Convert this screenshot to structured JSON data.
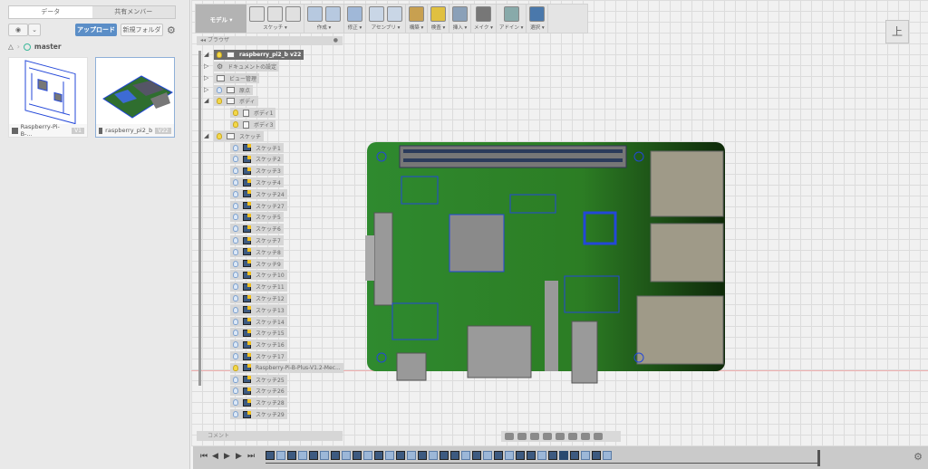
{
  "left_panel": {
    "tabs": [
      "データ",
      "共有メンバー"
    ],
    "upload_label": "アップロード",
    "new_folder_label": "新規フォルダ",
    "breadcrumb": "master",
    "files": [
      {
        "name": "Raspberry-Pi-B-...",
        "version": "V1"
      },
      {
        "name": "raspberry_pi2_b",
        "version": "V22"
      }
    ]
  },
  "toolbar": {
    "workspace": "モデル ▾",
    "groups": [
      {
        "label": "スケッチ ▾",
        "n": 3
      },
      {
        "label": "作成 ▾",
        "n": 2
      },
      {
        "label": "修正 ▾",
        "n": 1
      },
      {
        "label": "アセンブリ ▾",
        "n": 2
      },
      {
        "label": "構築 ▾",
        "n": 1
      },
      {
        "label": "検査 ▾",
        "n": 1
      },
      {
        "label": "挿入 ▾",
        "n": 1
      },
      {
        "label": "メイク ▾",
        "n": 1
      },
      {
        "label": "アドイン ▾",
        "n": 1
      },
      {
        "label": "選択 ▾",
        "n": 1
      }
    ]
  },
  "browser": {
    "title": "ブラウザ",
    "root": "raspberry_pi2_b v22",
    "items": [
      {
        "label": "ドキュメントの設定",
        "level": 1,
        "type": "gear",
        "arrow": "▷"
      },
      {
        "label": "ビュー管理",
        "level": 1,
        "type": "folder",
        "arrow": "▷"
      },
      {
        "label": "原点",
        "level": 1,
        "type": "folder",
        "arrow": "▷",
        "bulb": "off"
      },
      {
        "label": "ボディ",
        "level": 1,
        "type": "folder",
        "arrow": "◢",
        "bulb": "on"
      },
      {
        "label": "ボディ1",
        "level": 2,
        "type": "body",
        "bulb": "on"
      },
      {
        "label": "ボディ3",
        "level": 2,
        "type": "body",
        "bulb": "on"
      },
      {
        "label": "スケッチ",
        "level": 1,
        "type": "folder",
        "arrow": "◢",
        "bulb": "on"
      },
      {
        "label": "スケッチ1",
        "level": 2,
        "type": "sketch",
        "bulb": "off"
      },
      {
        "label": "スケッチ2",
        "level": 2,
        "type": "sketch",
        "bulb": "off"
      },
      {
        "label": "スケッチ3",
        "level": 2,
        "type": "sketch",
        "bulb": "off"
      },
      {
        "label": "スケッチ4",
        "level": 2,
        "type": "sketch",
        "bulb": "off"
      },
      {
        "label": "スケッチ24",
        "level": 2,
        "type": "sketch",
        "bulb": "off"
      },
      {
        "label": "スケッチ27",
        "level": 2,
        "type": "sketch",
        "bulb": "off"
      },
      {
        "label": "スケッチ5",
        "level": 2,
        "type": "sketch",
        "bulb": "off"
      },
      {
        "label": "スケッチ6",
        "level": 2,
        "type": "sketch",
        "bulb": "off"
      },
      {
        "label": "スケッチ7",
        "level": 2,
        "type": "sketch",
        "bulb": "off"
      },
      {
        "label": "スケッチ8",
        "level": 2,
        "type": "sketch",
        "bulb": "off"
      },
      {
        "label": "スケッチ9",
        "level": 2,
        "type": "sketch",
        "bulb": "off"
      },
      {
        "label": "スケッチ10",
        "level": 2,
        "type": "sketch",
        "bulb": "off"
      },
      {
        "label": "スケッチ11",
        "level": 2,
        "type": "sketch",
        "bulb": "off"
      },
      {
        "label": "スケッチ12",
        "level": 2,
        "type": "sketch",
        "bulb": "off"
      },
      {
        "label": "スケッチ13",
        "level": 2,
        "type": "sketch",
        "bulb": "off"
      },
      {
        "label": "スケッチ14",
        "level": 2,
        "type": "sketch",
        "bulb": "off"
      },
      {
        "label": "スケッチ15",
        "level": 2,
        "type": "sketch",
        "bulb": "off"
      },
      {
        "label": "スケッチ16",
        "level": 2,
        "type": "sketch",
        "bulb": "off"
      },
      {
        "label": "スケッチ17",
        "level": 2,
        "type": "sketch",
        "bulb": "off"
      },
      {
        "label": "Raspberry-Pi-B-Plus-V1.2-Mec...",
        "level": 2,
        "type": "sketch",
        "bulb": "on"
      },
      {
        "label": "スケッチ25",
        "level": 2,
        "type": "sketch",
        "bulb": "off"
      },
      {
        "label": "スケッチ26",
        "level": 2,
        "type": "sketch",
        "bulb": "off"
      },
      {
        "label": "スケッチ28",
        "level": 2,
        "type": "sketch",
        "bulb": "off"
      },
      {
        "label": "スケッチ29",
        "level": 2,
        "type": "sketch",
        "bulb": "off"
      }
    ]
  },
  "comment": {
    "label": "コメント"
  },
  "viewcube": {
    "face": "上"
  },
  "timeline": {
    "controls": [
      "⏮",
      "◀",
      "▶",
      "▶",
      "⏭"
    ],
    "steps": "sesesesesesesesessesesessesgsese"
  },
  "colors": {
    "accent": "#5b8ec7",
    "pcb": "#2f8a2f"
  }
}
